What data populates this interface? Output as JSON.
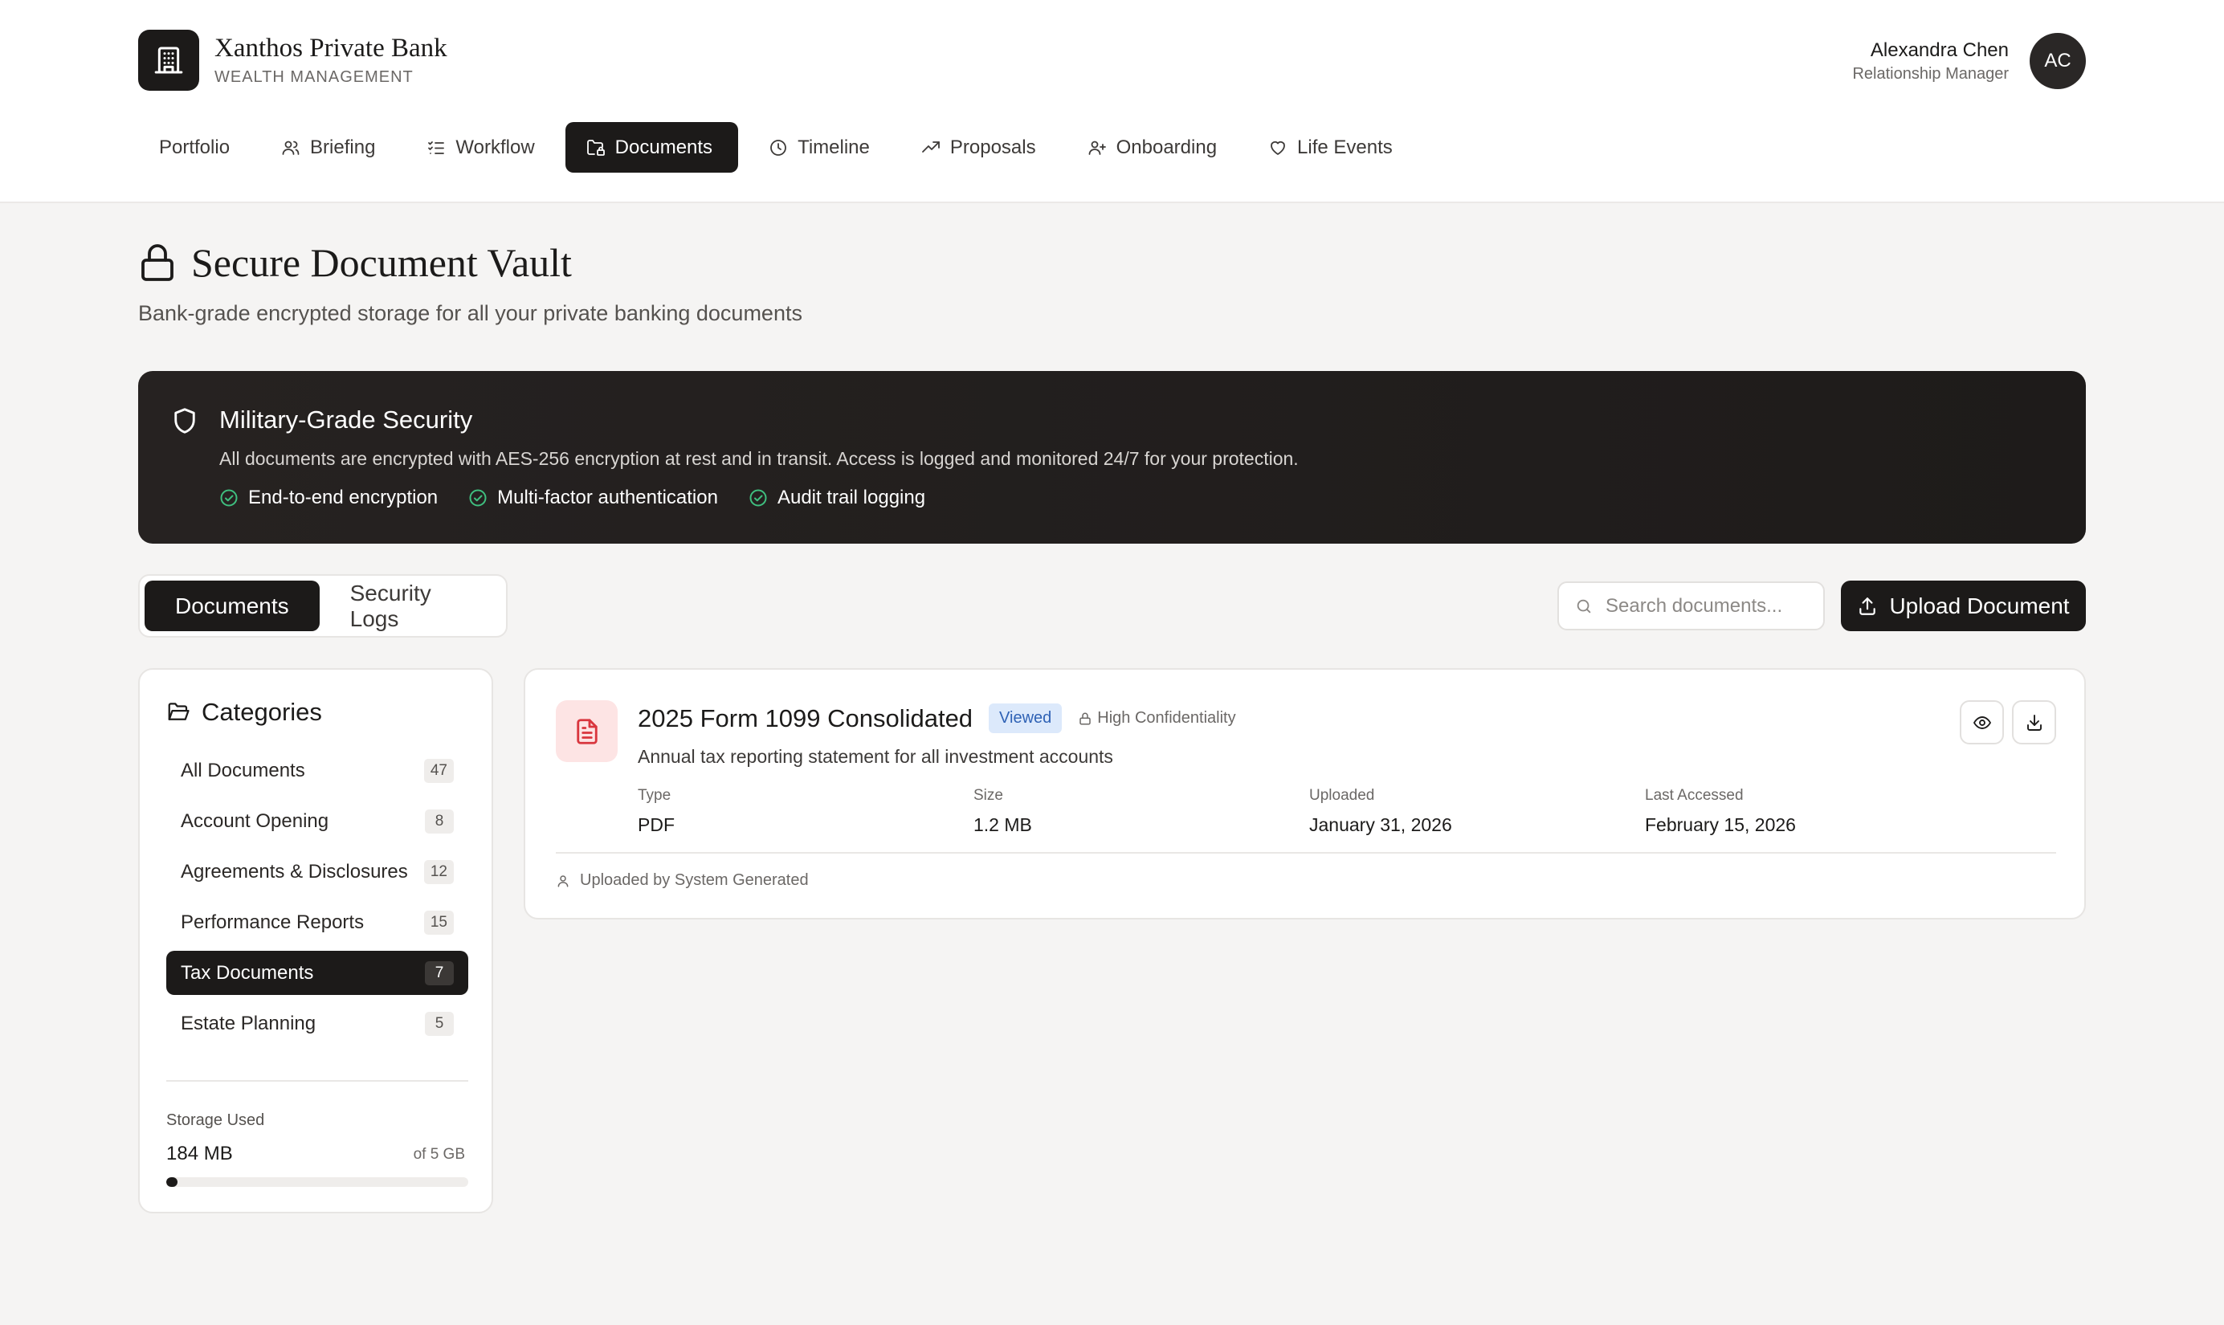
{
  "brand": {
    "name": "Xanthos Private Bank",
    "subtitle": "WEALTH MANAGEMENT"
  },
  "user": {
    "name": "Alexandra Chen",
    "role": "Relationship Manager",
    "initials": "AC"
  },
  "nav": [
    {
      "label": "Portfolio",
      "icon": "none"
    },
    {
      "label": "Briefing",
      "icon": "users-icon"
    },
    {
      "label": "Workflow",
      "icon": "list-checks-icon"
    },
    {
      "label": "Documents",
      "icon": "folder-lock-icon",
      "active": true
    },
    {
      "label": "Timeline",
      "icon": "clock-icon"
    },
    {
      "label": "Proposals",
      "icon": "trending-up-icon"
    },
    {
      "label": "Onboarding",
      "icon": "user-plus-icon"
    },
    {
      "label": "Life Events",
      "icon": "heart-icon"
    }
  ],
  "page": {
    "title": "Secure Document Vault",
    "subtitle": "Bank-grade encrypted storage for all your private banking documents"
  },
  "security_banner": {
    "title": "Military-Grade Security",
    "description": "All documents are encrypted with AES-256 encryption at rest and in transit. Access is logged and monitored 24/7 for your protection.",
    "features": [
      "End-to-end encryption",
      "Multi-factor authentication",
      "Audit trail logging"
    ]
  },
  "tabs": [
    {
      "label": "Documents",
      "active": true
    },
    {
      "label": "Security Logs",
      "active": false
    }
  ],
  "search": {
    "placeholder": "Search documents...",
    "value": ""
  },
  "upload": {
    "label": "Upload Document"
  },
  "categories": {
    "title": "Categories",
    "items": [
      {
        "label": "All Documents",
        "count": "47"
      },
      {
        "label": "Account Opening",
        "count": "8"
      },
      {
        "label": "Agreements & Disclosures",
        "count": "12"
      },
      {
        "label": "Performance Reports",
        "count": "15"
      },
      {
        "label": "Tax Documents",
        "count": "7",
        "active": true
      },
      {
        "label": "Estate Planning",
        "count": "5"
      }
    ]
  },
  "storage": {
    "label": "Storage Used",
    "used": "184 MB",
    "total": "of 5 GB",
    "used_fraction": 0.036
  },
  "document": {
    "title": "2025 Form 1099 Consolidated",
    "status": "Viewed",
    "confidentiality": "High Confidentiality",
    "description": "Annual tax reporting statement for all investment accounts",
    "meta": [
      {
        "label": "Type",
        "value": "PDF"
      },
      {
        "label": "Size",
        "value": "1.2 MB"
      },
      {
        "label": "Uploaded",
        "value": "January 31, 2026"
      },
      {
        "label": "Last Accessed",
        "value": "February 15, 2026"
      }
    ],
    "uploaded_by": "Uploaded by System Generated"
  },
  "colors": {
    "accent": "#1c1a19",
    "success": "#3fbf7f",
    "danger": "#d9363e",
    "viewed_badge_bg": "#dce9fb",
    "viewed_badge_text": "#2f62b5"
  }
}
